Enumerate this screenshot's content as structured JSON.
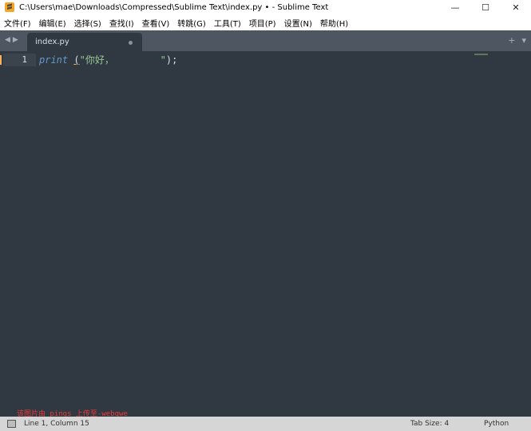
{
  "window": {
    "title": "C:\\Users\\mae\\Downloads\\Compressed\\Sublime Text\\index.py • - Sublime Text",
    "minimize": "—",
    "maximize": "☐",
    "close": "✕"
  },
  "menu": {
    "items": [
      "文件(F)",
      "编辑(E)",
      "选择(S)",
      "查找(I)",
      "查看(V)",
      "转跳(G)",
      "工具(T)",
      "项目(P)",
      "设置(N)",
      "帮助(H)"
    ]
  },
  "tabs": {
    "nav_left": "◀",
    "nav_right": "▶",
    "active_label": "index.py",
    "new_tab": "+",
    "tab_menu": "▾"
  },
  "editor": {
    "line_number": "1",
    "code": {
      "keyword": "print",
      "space": " ",
      "open_paren": "(",
      "string": "\"你好，        \"",
      "close": ");"
    }
  },
  "watermark": "该图片由 pings 上传至-webqwe",
  "status": {
    "position": "Line 1, Column 15",
    "tab_size": "Tab Size: 4",
    "syntax": "Python"
  },
  "colors": {
    "editor_bg": "#303841",
    "keyword": "#6699cc",
    "string": "#99c794",
    "gutter_marker": "#f9ae58",
    "watermark": "#ec3a3a"
  }
}
